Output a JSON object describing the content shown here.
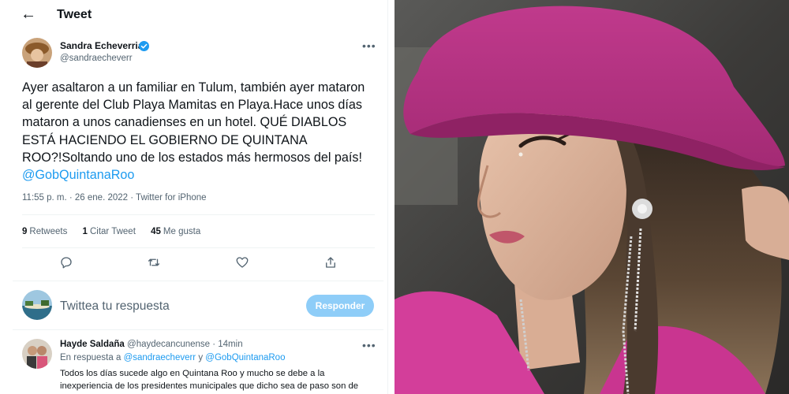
{
  "header": {
    "title": "Tweet",
    "back_icon": "arrow-left-icon"
  },
  "tweet": {
    "author_name": "Sandra Echeverria",
    "author_handle": "@sandraecheverr",
    "verified_icon": "verified-badge-icon",
    "text": "Ayer asaltaron a un familiar en Tulum, también ayer mataron al gerente del Club Playa Mamitas en Playa.Hace unos días mataron a unos canadienses en un hotel. QUÉ DIABLOS ESTÁ HACIENDO EL GOBIERNO DE QUINTANA ROO?!Soltando uno de los estados más hermosos del país! ",
    "mention": "@GobQuintanaRoo",
    "timestamp": "11:55 p. m. · 26 ene. 2022 · Twitter for iPhone",
    "stats": {
      "retweets_count": "9",
      "retweets_label": "Retweets",
      "quotes_count": "1",
      "quotes_label": "Citar Tweet",
      "likes_count": "45",
      "likes_label": "Me gusta"
    },
    "actions": [
      "reply-icon",
      "retweet-icon",
      "like-icon",
      "share-icon"
    ]
  },
  "compose": {
    "placeholder": "Twittea tu respuesta",
    "button_label": "Responder"
  },
  "reply": {
    "name": "Hayde Saldaña",
    "handle_time": " @haydecancunense · 14min",
    "in_reply_prefix": "En respuesta a ",
    "in_reply_user1": "@sandraecheverr",
    "in_reply_and": " y ",
    "in_reply_user2": "@GobQuintanaRoo",
    "text": "Todos los días sucede algo en Quintana Roo y mucho se debe a la inexperiencia de los presidentes municipales que dicho sea de paso son de"
  },
  "colors": {
    "accent": "#1d9bf0",
    "button_disabled": "#8ecdf8",
    "hat": "#b5317f"
  }
}
